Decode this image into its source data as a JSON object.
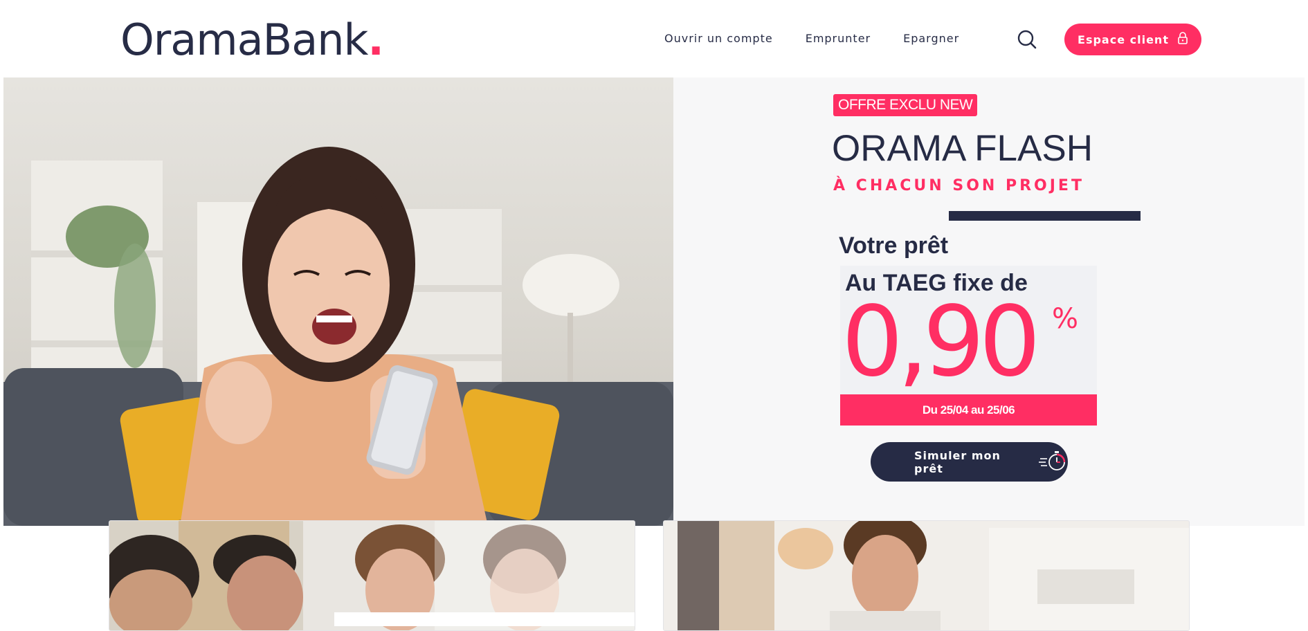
{
  "brand": {
    "name": "OramaBank",
    "dot": ".",
    "accent_color": "#ff2e63",
    "dark_color": "#262b45"
  },
  "nav": {
    "items": [
      {
        "label": "Ouvrir un compte"
      },
      {
        "label": "Emprunter"
      },
      {
        "label": "Epargner"
      }
    ],
    "search_icon": "search-icon",
    "client_button": {
      "label": "Espace client",
      "icon": "lock-icon"
    }
  },
  "hero": {
    "photo_alt": "woman-celebrating-with-phone",
    "badge": "OFFRE EXCLU NEW",
    "title": "ORAMA FLASH",
    "subtitle": "À CHACUN SON PROJET",
    "loan_label": "Votre prêt",
    "rate_label": "Au TAEG fixe de",
    "rate_value": "0,90",
    "rate_unit": "%",
    "period": "Du 25/04 au 25/06",
    "cta": {
      "label": "Simuler mon prêt",
      "icon": "stopwatch-icon"
    }
  },
  "cards": [
    {
      "image": "group-of-friends-photo"
    },
    {
      "image": "man-at-cafe-photo"
    }
  ]
}
